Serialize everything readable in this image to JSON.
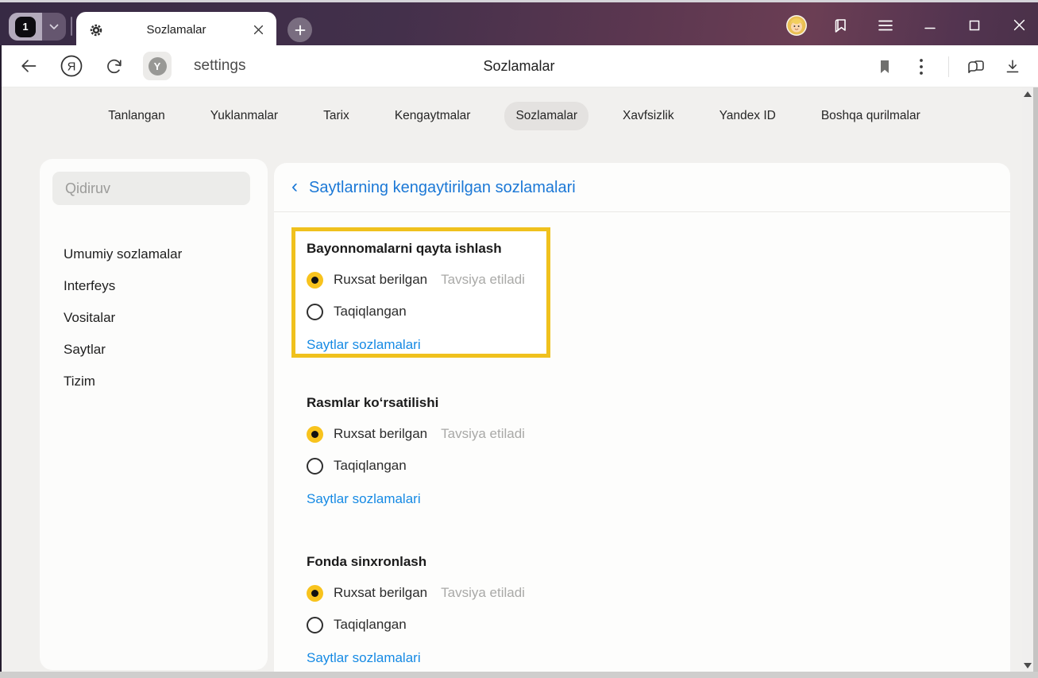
{
  "window": {
    "tab_count": "1",
    "controls": {
      "minimize": "minimize",
      "maximize": "maximize",
      "close": "✕"
    }
  },
  "tab_bar": {
    "tab_title": "Sozlamalar",
    "close_glyph": "✕",
    "plus_glyph": "+"
  },
  "toolbar": {
    "url_text": "settings",
    "page_title": "Sozlamalar",
    "protect_letter": "Y",
    "yandex_letter": "Я"
  },
  "nav": {
    "tabs": [
      {
        "label": "Tanlangan",
        "active": false
      },
      {
        "label": "Yuklanmalar",
        "active": false
      },
      {
        "label": "Tarix",
        "active": false
      },
      {
        "label": "Kengaytmalar",
        "active": false
      },
      {
        "label": "Sozlamalar",
        "active": true
      },
      {
        "label": "Xavfsizlik",
        "active": false
      },
      {
        "label": "Yandex ID",
        "active": false
      },
      {
        "label": "Boshqa qurilmalar",
        "active": false
      }
    ]
  },
  "sidebar": {
    "search_placeholder": "Qidiruv",
    "items": [
      {
        "label": "Umumiy sozlamalar"
      },
      {
        "label": "Interfeys"
      },
      {
        "label": "Vositalar"
      },
      {
        "label": "Saytlar"
      },
      {
        "label": "Tizim"
      }
    ]
  },
  "main": {
    "back_chevron": "‹",
    "heading": "Saytlarning kengaytirilgan sozlamalari",
    "sections": [
      {
        "title": "Bayonnomalarni qayta ishlash",
        "highlighted": true,
        "options": [
          {
            "label": "Ruxsat berilgan",
            "selected": true,
            "note": "Tavsiya etiladi"
          },
          {
            "label": "Taqiqlangan",
            "selected": false,
            "note": ""
          }
        ],
        "link": "Saytlar sozlamalari"
      },
      {
        "title": "Rasmlar koʻrsatilishi",
        "highlighted": false,
        "options": [
          {
            "label": "Ruxsat berilgan",
            "selected": true,
            "note": "Tavsiya etiladi"
          },
          {
            "label": "Taqiqlangan",
            "selected": false,
            "note": ""
          }
        ],
        "link": "Saytlar sozlamalari"
      },
      {
        "title": "Fonda sinxronlash",
        "highlighted": false,
        "options": [
          {
            "label": "Ruxsat berilgan",
            "selected": true,
            "note": "Tavsiya etiladi"
          },
          {
            "label": "Taqiqlangan",
            "selected": false,
            "note": ""
          }
        ],
        "link": "Saytlar sozlamalari"
      }
    ]
  },
  "icons": {
    "gear": "gear-icon",
    "back": "back-arrow-icon",
    "refresh": "refresh-icon",
    "bookmark": "bookmark-icon",
    "kebab": "kebab-menu-icon",
    "download": "download-icon",
    "sidebar_panels": "side-panels-icon",
    "bookmarks_flag": "bookmarks-flag-icon",
    "hamburger": "hamburger-menu-icon",
    "avatar": "user-avatar"
  },
  "colors": {
    "accent_blue": "#1b78d6",
    "link_blue": "#168ae4",
    "highlight_yellow": "#f0c11d",
    "radio_yellow": "#f8c31d",
    "chrome_gradient_start": "#372a44",
    "chrome_gradient_end": "#6b3e54"
  }
}
